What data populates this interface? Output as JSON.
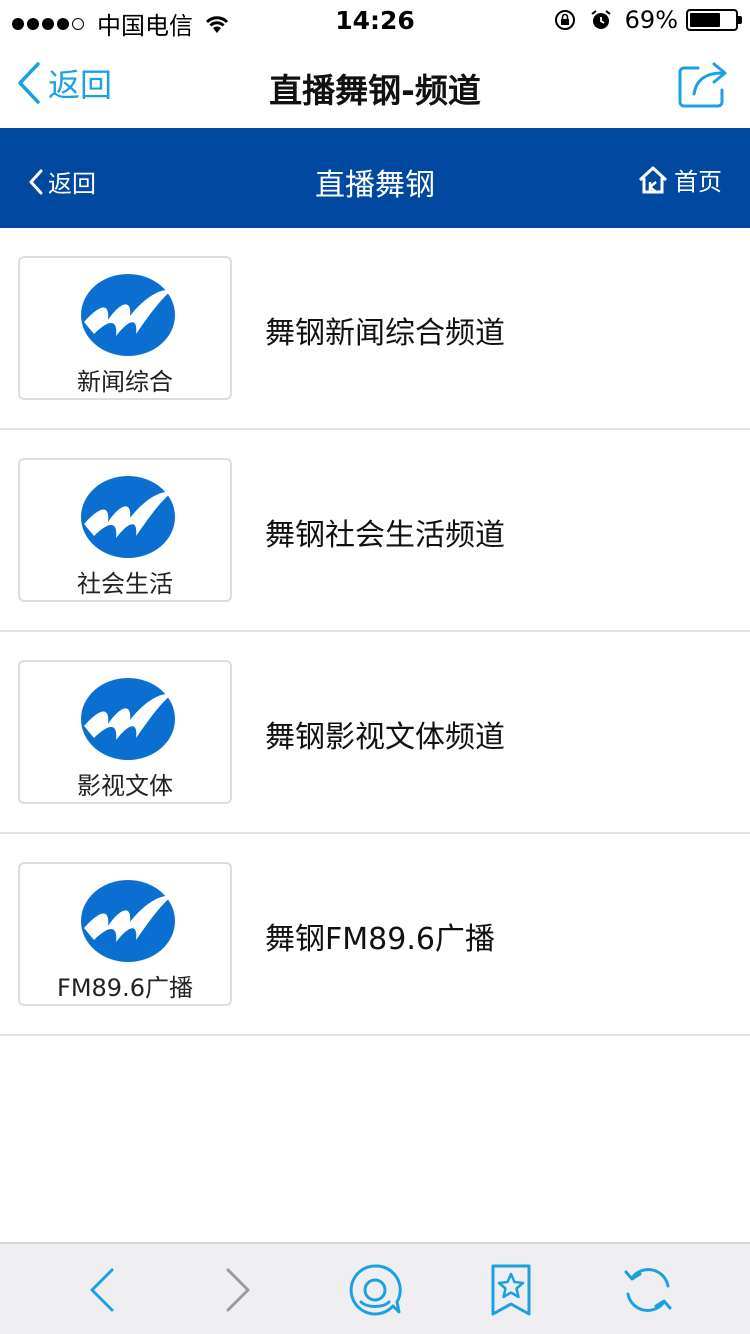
{
  "status_bar": {
    "carrier": "中国电信",
    "time": "14:26",
    "battery_percent": "69%",
    "battery_level": 0.69,
    "signal_bars": 4
  },
  "nav": {
    "back_label": "返回",
    "title": "直播舞钢-频道",
    "share_icon": "share-icon"
  },
  "header": {
    "back_label": "返回",
    "title": "直播舞钢",
    "home_label": "首页",
    "background": "#0048a0"
  },
  "channels": [
    {
      "thumb_label": "新闻综合",
      "name": "舞钢新闻综合频道"
    },
    {
      "thumb_label": "社会生活",
      "name": "舞钢社会生活频道"
    },
    {
      "thumb_label": "影视文体",
      "name": "舞钢影视文体频道"
    },
    {
      "thumb_label": "FM89.6广播",
      "name": "舞钢FM89.6广播"
    }
  ],
  "toolbar": {
    "icons": [
      "back-arrow-icon",
      "forward-arrow-icon",
      "chat-icon",
      "bookmark-star-icon",
      "refresh-icon"
    ]
  },
  "colors": {
    "accent": "#1ba1e2",
    "header_blue": "#0048a0",
    "logo_blue": "#0a6fd0"
  }
}
